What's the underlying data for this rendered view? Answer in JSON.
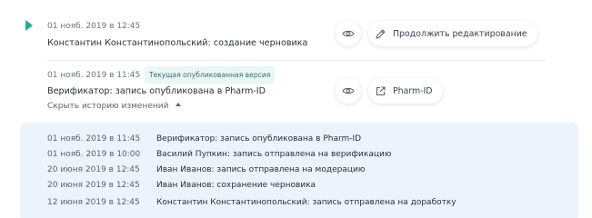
{
  "colors": {
    "accent": "#21a99a",
    "history_bg": "#ecf3fd",
    "badge_bg": "#e8f6f4"
  },
  "entries": [
    {
      "date": "01 нояб. 2019 в 12:45",
      "title": "Константин Константинопольский: создание черновика",
      "view_icon": "eye-icon",
      "action_icon": "pencil-icon",
      "action_label": "Продолжить редактирование"
    },
    {
      "date": "01 нояб. 2019 в 11:45",
      "badge": "Текущая опубликованная версия",
      "title": "Верификатор: запись опубликована в Pharm-ID",
      "view_icon": "eye-icon",
      "action_icon": "external-link-icon",
      "action_label": "Pharm-ID",
      "toggle_label": "Скрыть историю изменений"
    }
  ],
  "history": [
    {
      "date": "01 нояб. 2019 в 11:45",
      "text": "Верификатор: запись опубликована в Pharm-ID"
    },
    {
      "date": "01 нояб. 2019 в 10:00",
      "text": "Василий Пупкин: запись отправлена на верификацию"
    },
    {
      "date": "20 июня 2019 в 12:45",
      "text": "Иван Иванов: запись отправлена на модерацию"
    },
    {
      "date": "20 июня 2019 в 12:45",
      "text": "Иван Иванов: сохранение черновика"
    },
    {
      "date": "12 июня 2019 в 12:45",
      "text": "Константин Константинопольский: запись отправлена на доработку"
    }
  ]
}
